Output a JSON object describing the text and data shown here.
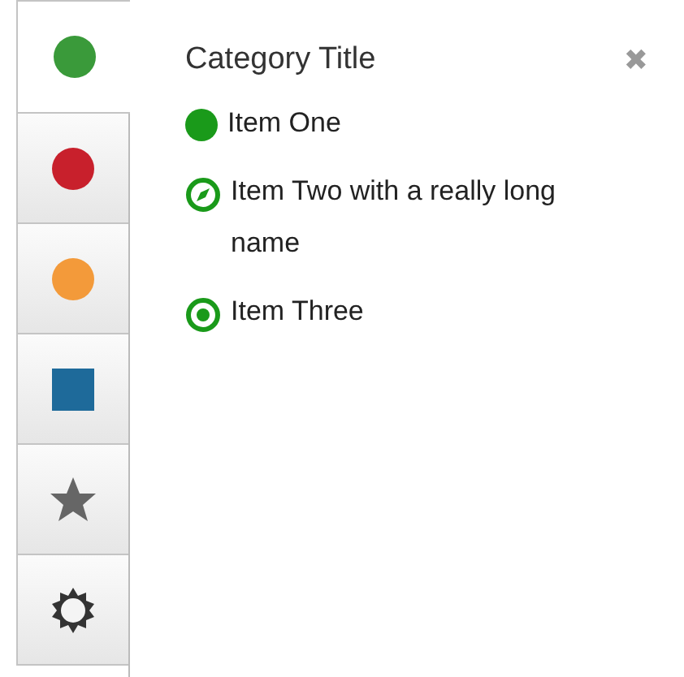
{
  "sidebar": {
    "tabs": [
      {
        "kind": "circle",
        "color": "#3a9a3a",
        "selected": true
      },
      {
        "kind": "circle",
        "color": "#c8202c",
        "selected": false
      },
      {
        "kind": "circle",
        "color": "#f39a3a",
        "selected": false
      },
      {
        "kind": "square",
        "color": "#1e6a9a",
        "selected": false
      },
      {
        "kind": "star",
        "color": "#666666",
        "selected": false
      },
      {
        "kind": "gear",
        "color": "#333333",
        "selected": false
      }
    ]
  },
  "panel": {
    "title": "Category Title",
    "close": "✖",
    "items": [
      {
        "kind": "dot",
        "label": "Item One"
      },
      {
        "kind": "compass",
        "label": "Item Two with a really long name"
      },
      {
        "kind": "target",
        "label": "Item Three"
      }
    ]
  }
}
